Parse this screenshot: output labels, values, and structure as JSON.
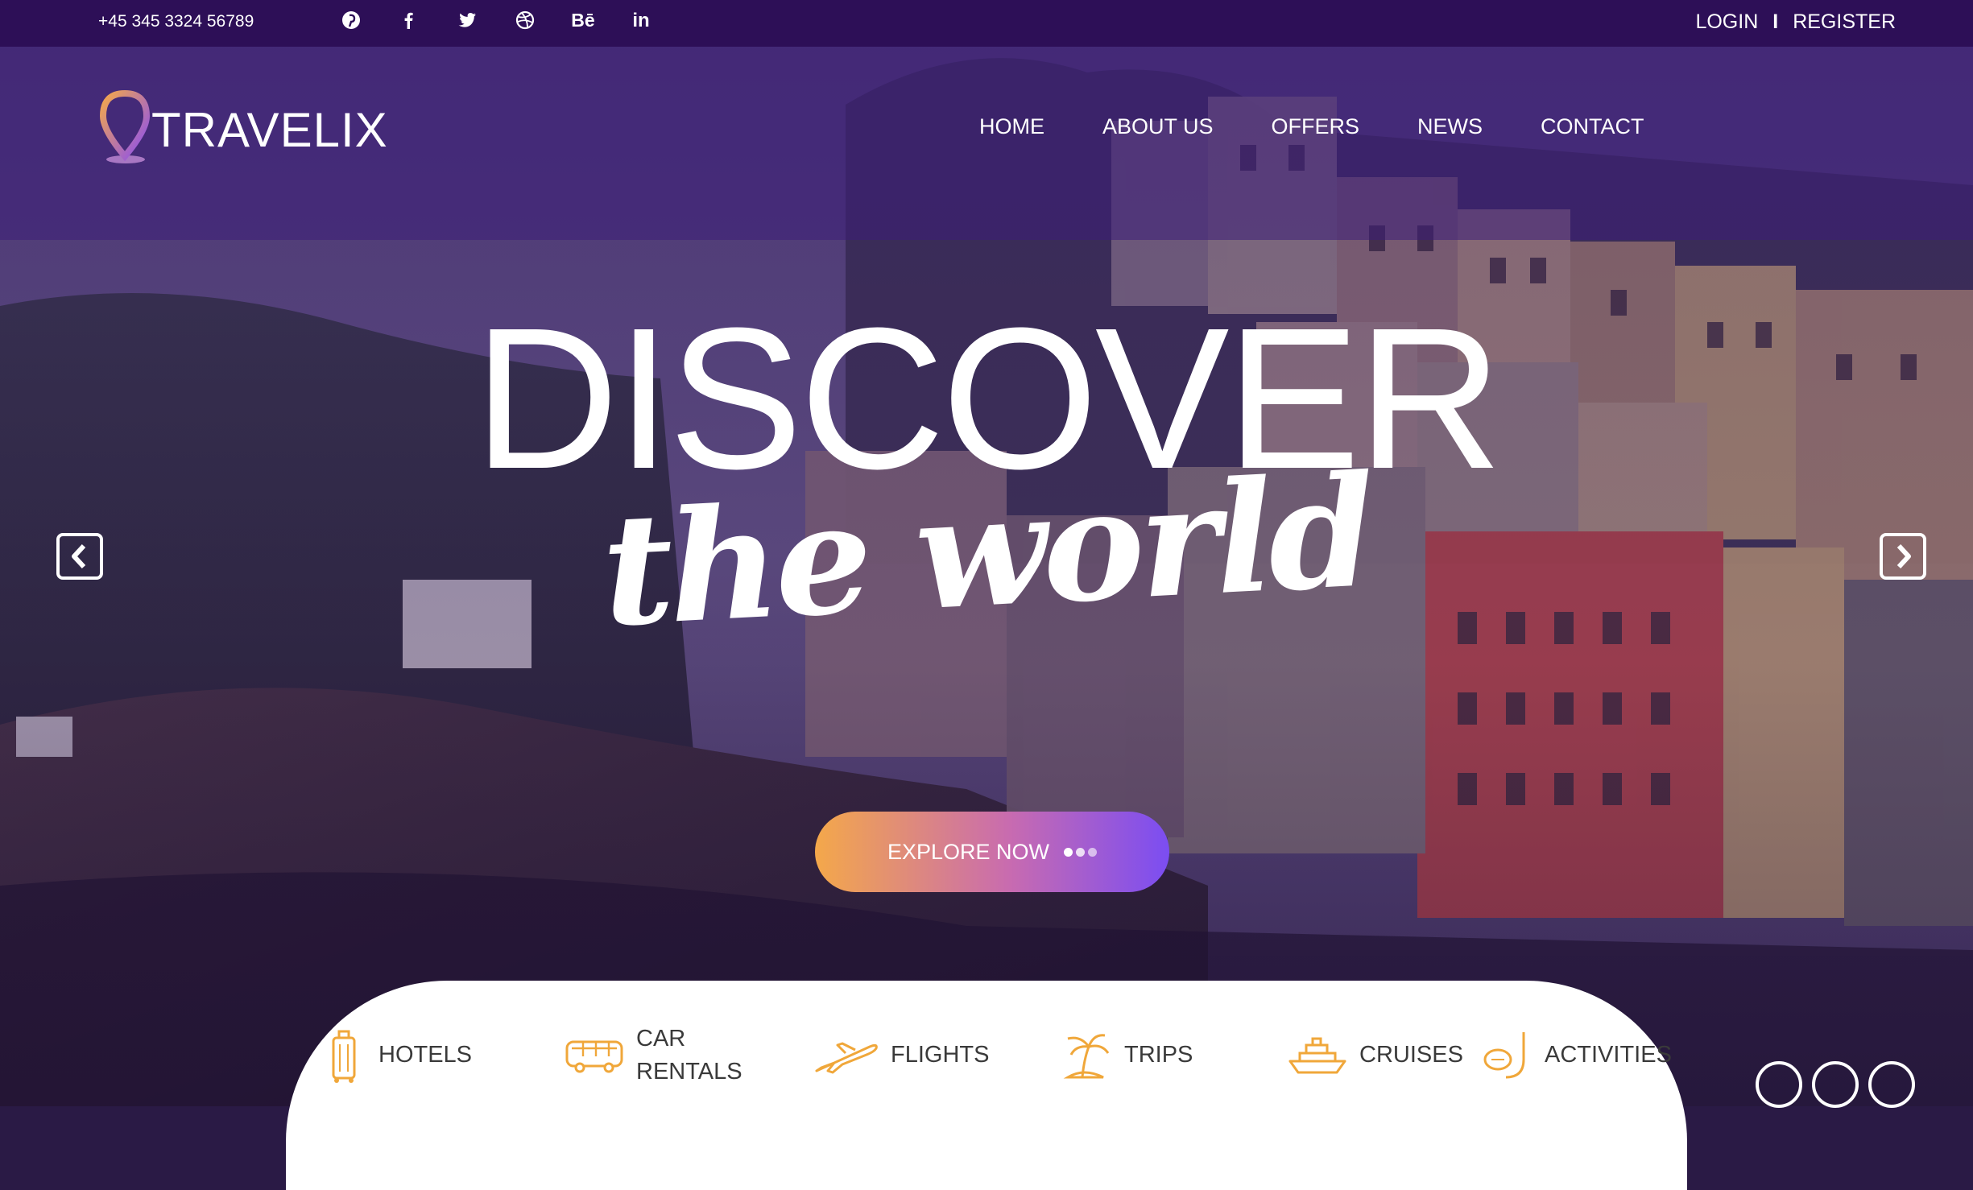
{
  "topbar": {
    "phone": "+45 345 3324 56789",
    "social": [
      {
        "icon": "pinterest-icon",
        "glyph": "ⓟ"
      },
      {
        "icon": "facebook-icon",
        "glyph": "f"
      },
      {
        "icon": "twitter-icon",
        "glyph": "t"
      },
      {
        "icon": "dribbble-icon",
        "glyph": "◎"
      },
      {
        "icon": "behance-icon",
        "glyph": "Bē"
      },
      {
        "icon": "linkedin-icon",
        "glyph": "in"
      }
    ],
    "login": "LOGIN",
    "separator": "I",
    "register": "REGISTER"
  },
  "header": {
    "logo_text": "TRAVELIX",
    "nav": [
      "HOME",
      "ABOUT US",
      "OFFERS",
      "NEWS",
      "CONTACT"
    ]
  },
  "hero": {
    "title": "DISCOVER",
    "subtitle": "the world",
    "button_label": "EXPLORE NOW"
  },
  "search_tabs": [
    {
      "label": "HOTELS",
      "icon": "suitcase-icon"
    },
    {
      "label": "CAR\nRENTALS",
      "icon": "bus-icon"
    },
    {
      "label": "FLIGHTS",
      "icon": "airplane-icon"
    },
    {
      "label": "TRIPS",
      "icon": "palm-island-icon"
    },
    {
      "label": "CRUISES",
      "icon": "ship-icon"
    },
    {
      "label": "ACTIVITIES",
      "icon": "snorkel-icon"
    }
  ],
  "colors": {
    "topbar": "#2d0f57",
    "accent_orange": "#f4a84a",
    "accent_purple": "#7b4df2",
    "icon_orange": "#f0a73a"
  }
}
